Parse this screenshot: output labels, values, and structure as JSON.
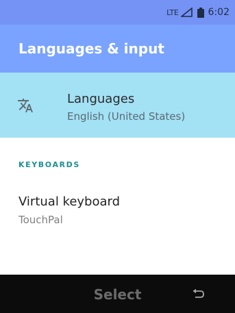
{
  "status_bar": {
    "network": "LTE",
    "signal_icon": "signal-icon",
    "battery_icon": "battery-icon",
    "time": "6:02"
  },
  "header": {
    "title": "Languages & input"
  },
  "languages_item": {
    "icon": "translate-icon",
    "title": "Languages",
    "subtitle": "English (United States)"
  },
  "keyboards_section": {
    "header": "KEYBOARDS",
    "items": [
      {
        "title": "Virtual keyboard",
        "subtitle": "TouchPal"
      }
    ]
  },
  "softkeys": {
    "center_label": "Select",
    "right_icon": "back-icon"
  },
  "colors": {
    "status_bar": "#7593f5",
    "app_bar": "#79a3ff",
    "selected_row": "#a3e1f5",
    "section_header": "#1d8f8f",
    "softkey_bar": "#0c0c0c"
  }
}
